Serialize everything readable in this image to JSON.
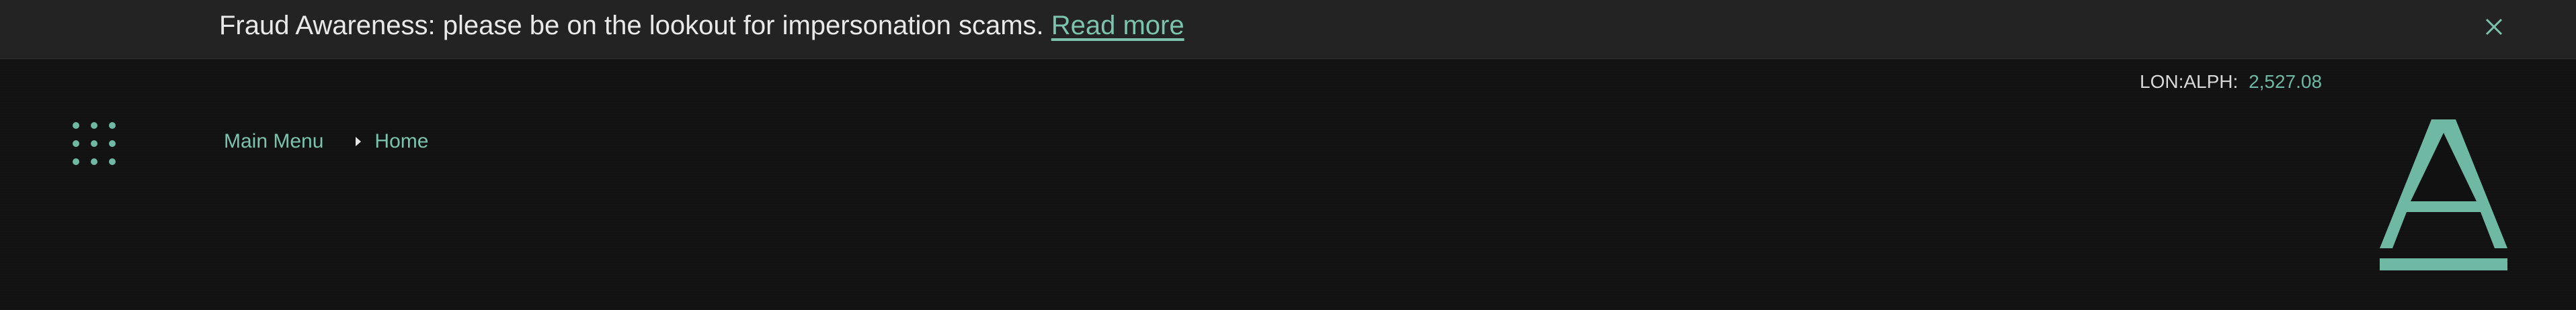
{
  "banner": {
    "message": "Fraud Awareness: please be on the lookout for impersonation scams.",
    "link_label": "Read more",
    "close_icon": "close-icon"
  },
  "nav": {
    "menu_icon": "grid-menu-icon",
    "breadcrumb": [
      {
        "label": "Main Menu"
      },
      {
        "label": "Home"
      }
    ],
    "separator_icon": "caret-right-icon"
  },
  "ticker": {
    "label": "LON:ALPH:",
    "value": "2,527.08"
  },
  "logo": {
    "icon": "alpha-logo-icon",
    "letter": "A"
  },
  "colors": {
    "accent": "#6fb9a4",
    "banner_bg": "#232323",
    "page_bg": "#111111",
    "banner_text": "#e9e9e9"
  }
}
